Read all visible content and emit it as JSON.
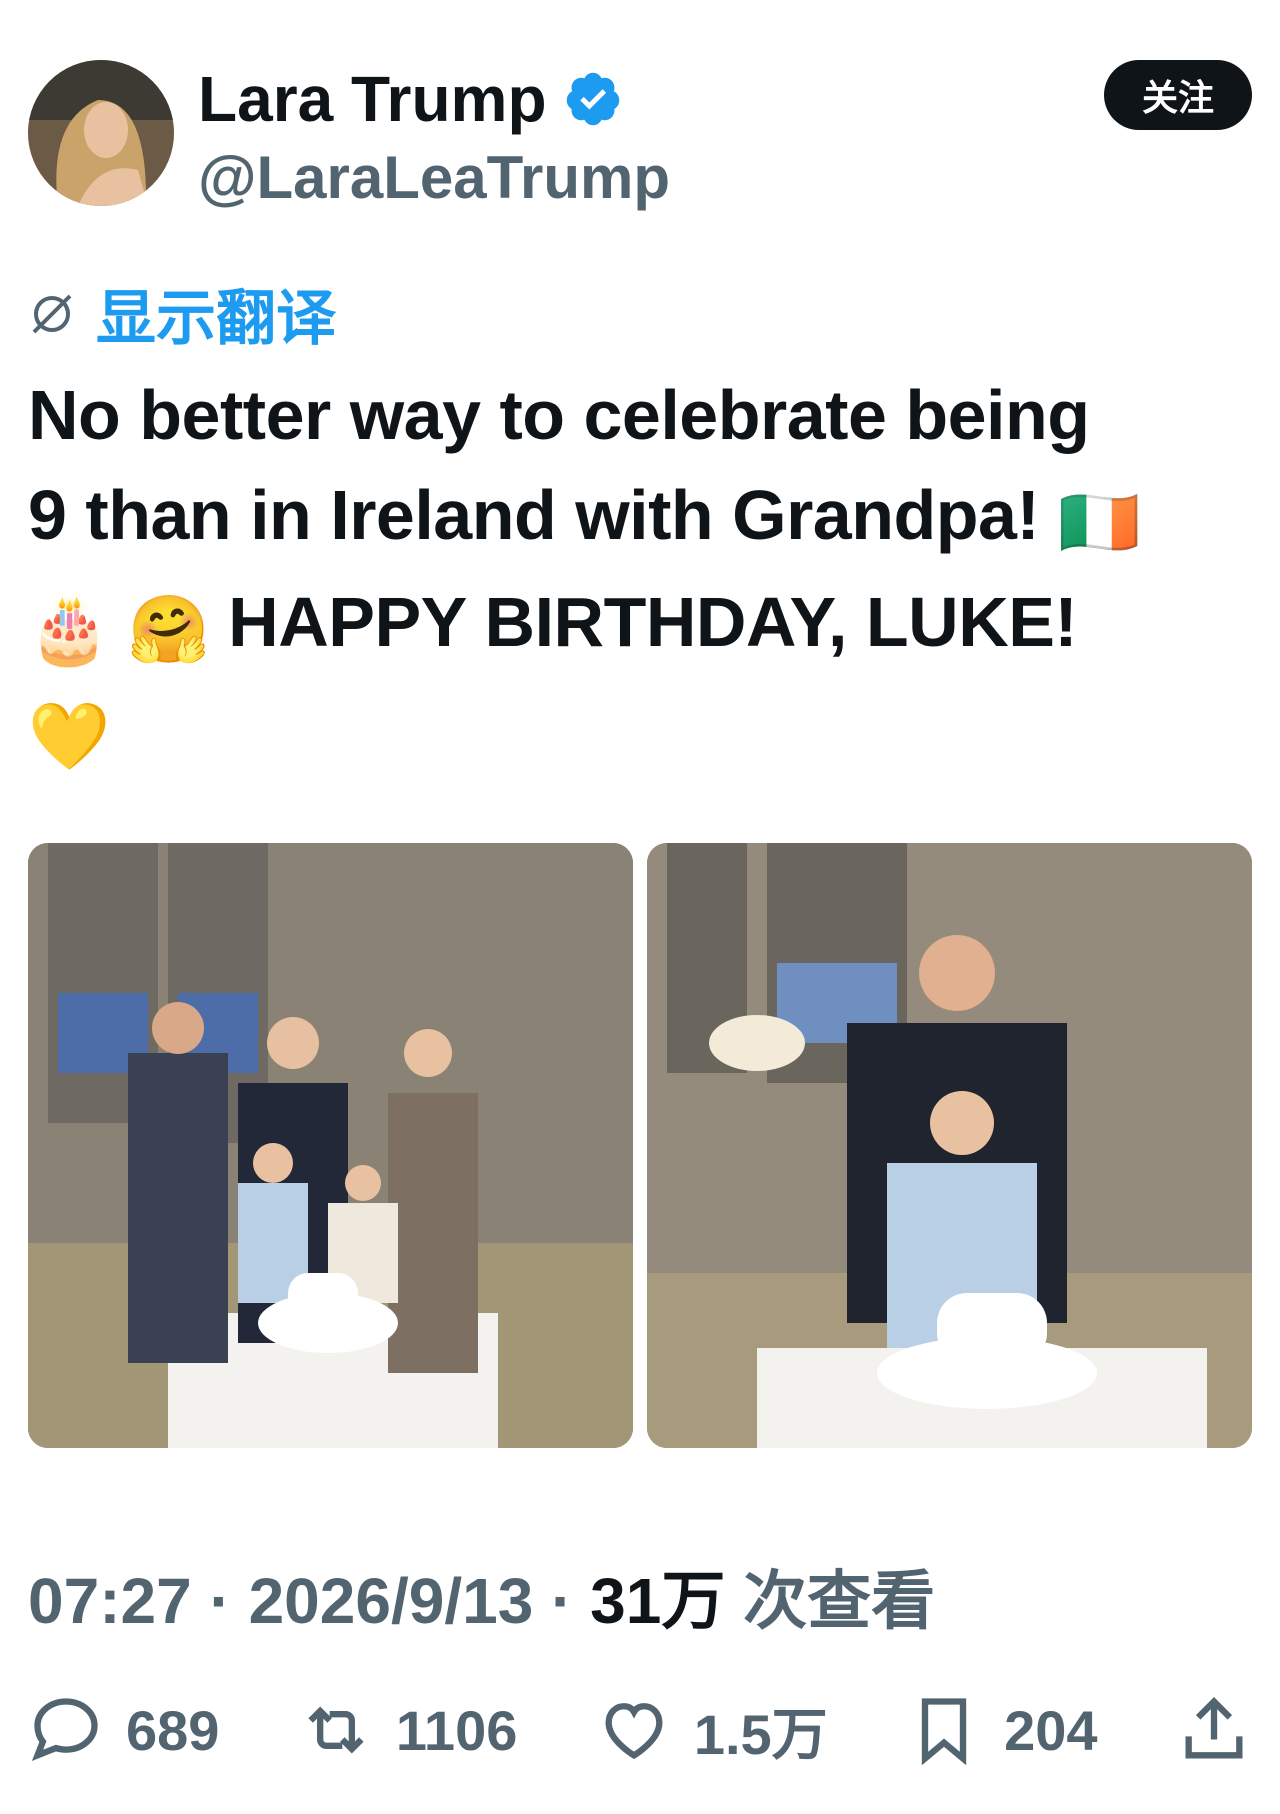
{
  "author": {
    "display_name": "Lara Trump",
    "handle": "@LaraLeaTrump",
    "verified": true,
    "verified_color": "#1d9bf0"
  },
  "follow_label": "关注",
  "translate_label": "显示翻译",
  "tweet": {
    "line1": "No better way to celebrate being",
    "line2": "9 than in Ireland with Grandpa!",
    "line2_emoji": "🇮🇪",
    "line3_emoji": "🎂 🤗",
    "line3": "HAPPY BIRTHDAY, LUKE!",
    "line4_emoji": "💛"
  },
  "meta": {
    "time": "07:27",
    "sep1": " · ",
    "date": "2026/9/13",
    "sep2": " · ",
    "views": "31万",
    "views_suffix": " 次查看"
  },
  "actions": {
    "replies": "689",
    "reposts": "1106",
    "likes": "1.5万",
    "bookmarks": "204"
  },
  "colors": {
    "accent": "#1d9bf0",
    "secondary_text": "#536471",
    "primary_text": "#0f1419"
  }
}
